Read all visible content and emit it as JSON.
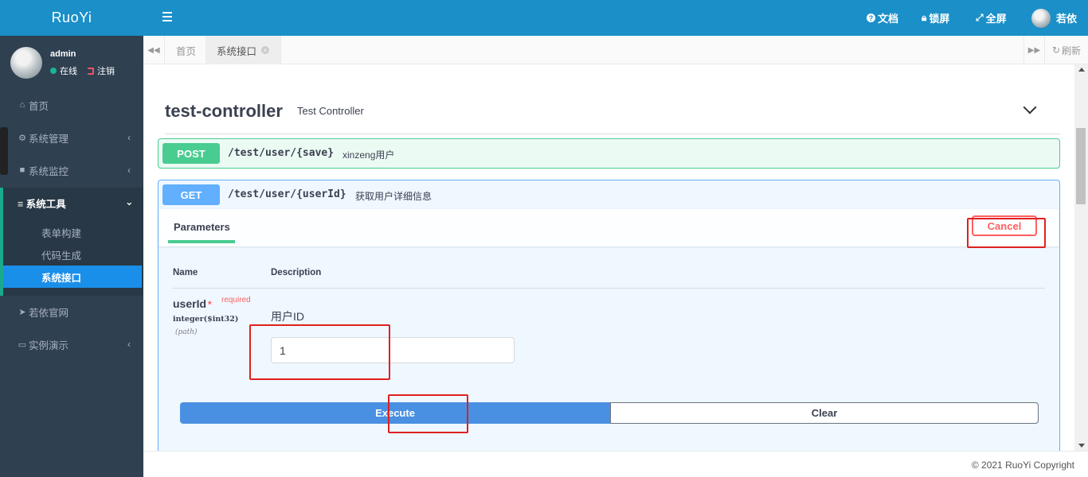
{
  "app": {
    "logo": "RuoYi"
  },
  "user": {
    "name": "admin",
    "status": "在线",
    "logout": "注销"
  },
  "sidebar": {
    "items": [
      {
        "label": "首页",
        "icon": "home-icon"
      },
      {
        "label": "系统管理",
        "icon": "gear-icon"
      },
      {
        "label": "系统监控",
        "icon": "video-icon"
      },
      {
        "label": "系统工具",
        "icon": "bars-icon",
        "expanded": true
      },
      {
        "label": "若依官网",
        "icon": "send-icon"
      },
      {
        "label": "实例演示",
        "icon": "desktop-icon"
      }
    ],
    "tools_sub": [
      {
        "label": "表单构建"
      },
      {
        "label": "代码生成"
      },
      {
        "label": "系统接口",
        "active": true
      }
    ]
  },
  "header": {
    "docs": "文档",
    "lock": "锁屏",
    "fullscreen": "全屏",
    "username": "若依"
  },
  "tabs": {
    "items": [
      {
        "label": "首页"
      },
      {
        "label": "系统接口",
        "active": true
      }
    ],
    "refresh": "刷新"
  },
  "swagger": {
    "controller": {
      "name": "test-controller",
      "description": "Test Controller"
    },
    "post": {
      "method": "POST",
      "path": "/test/user/{save}",
      "summary": "xinzeng用户"
    },
    "get": {
      "method": "GET",
      "path": "/test/user/{userId}",
      "summary": "获取用户详细信息",
      "params_tab": "Parameters",
      "cancel": "Cancel",
      "col_name": "Name",
      "col_desc": "Description",
      "param": {
        "name": "userId",
        "star": "*",
        "required": "required",
        "type": "integer($int32)",
        "in": "(path)",
        "description": "用户ID",
        "value": "1"
      },
      "execute": "Execute",
      "clear": "Clear"
    }
  },
  "footer": {
    "copyright": "© 2021 RuoYi Copyright"
  },
  "colors": {
    "brand": "#1a8fc8",
    "sidebar": "#2f4050",
    "post": "#49cc90",
    "get": "#61affe",
    "execute": "#4990e2",
    "cancel": "#ff6060"
  }
}
